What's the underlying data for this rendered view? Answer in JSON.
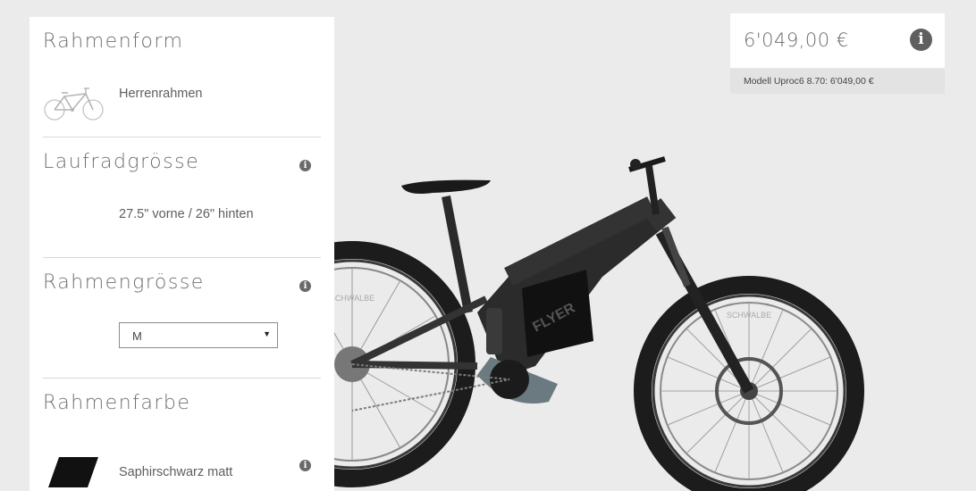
{
  "config": {
    "frame_shape": {
      "title": "Rahmenform",
      "value": "Herrenrahmen",
      "icon": "mens-frame-bike-icon"
    },
    "wheel_size": {
      "title": "Laufradgrösse",
      "value": "27.5\" vorne / 26\" hinten"
    },
    "frame_size": {
      "title": "Rahmengrösse",
      "selected": "M"
    },
    "frame_color": {
      "title": "Rahmenfarbe",
      "value": "Saphirschwarz matt",
      "swatch_color": "#111111"
    },
    "info_glyph": "i"
  },
  "price": {
    "total": "6'049,00 €",
    "info_glyph": "i",
    "model_line": "Modell Uproc6 8.70: 6'049,00 €"
  },
  "bike": {
    "tire_brand": "SCHWALBE",
    "down_tube_logo": "FLYER",
    "accent_color": "#1e1e1e"
  }
}
